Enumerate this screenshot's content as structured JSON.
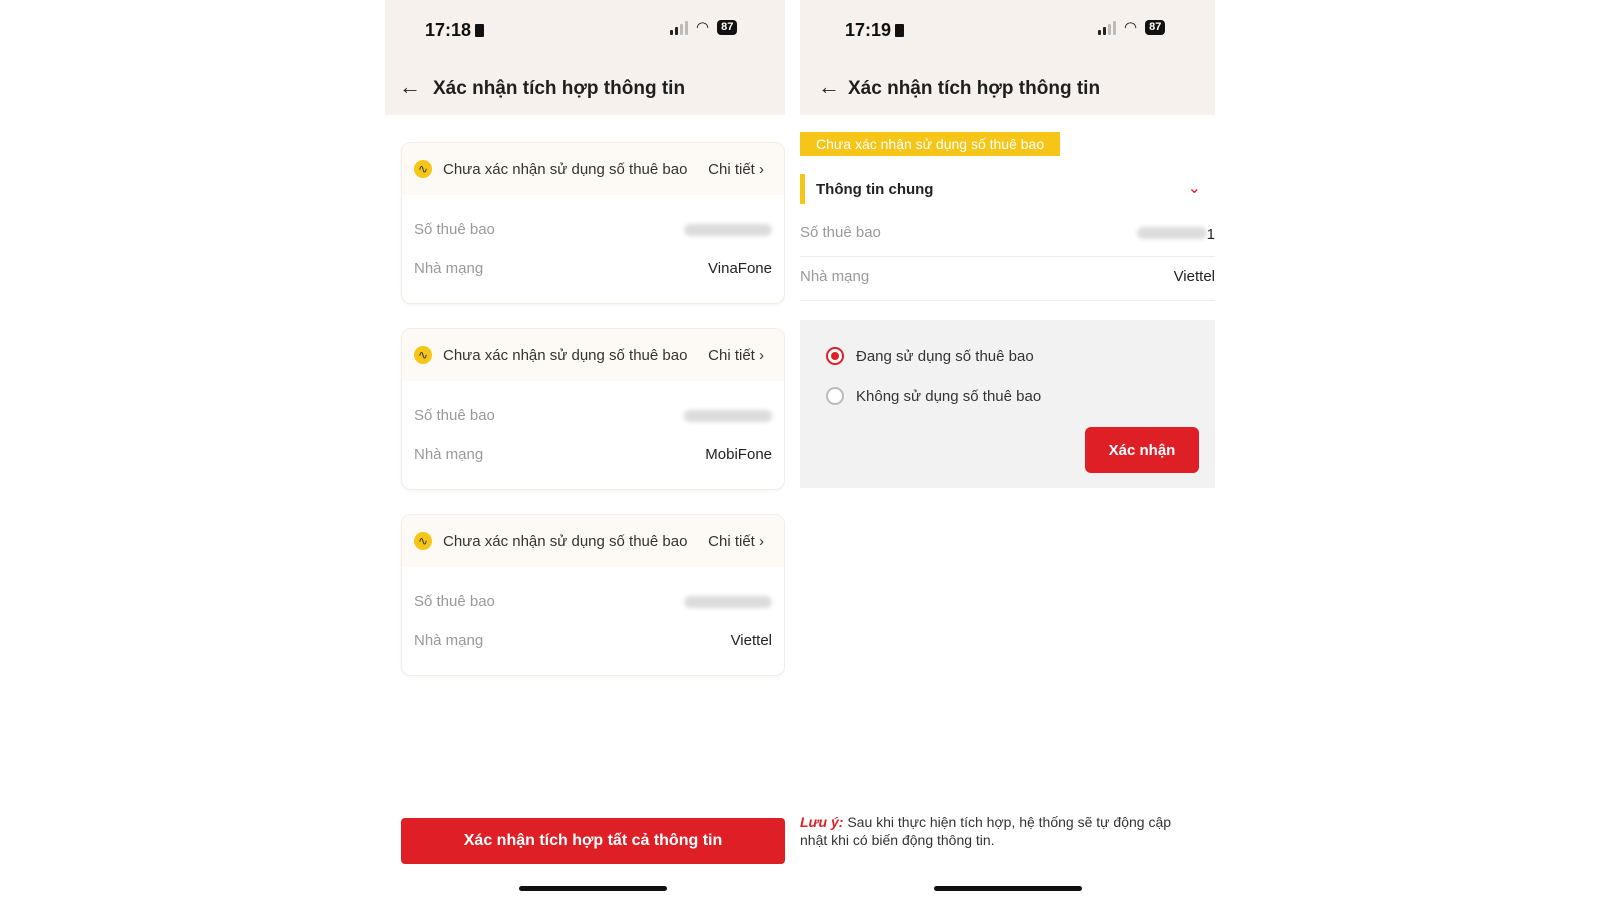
{
  "left": {
    "status": {
      "time": "17:18",
      "battery": "87"
    },
    "title": "Xác nhận tích hợp thông tin",
    "cards": [
      {
        "status": "Chưa xác nhận sử dụng số thuê bao",
        "detail": "Chi tiết",
        "subscriber_label": "Số thuê bao",
        "carrier_label": "Nhà mạng",
        "carrier": "VinaFone"
      },
      {
        "status": "Chưa xác nhận sử dụng số thuê bao",
        "detail": "Chi tiết",
        "subscriber_label": "Số thuê bao",
        "carrier_label": "Nhà mạng",
        "carrier": "MobiFone"
      },
      {
        "status": "Chưa xác nhận sử dụng số thuê bao",
        "detail": "Chi tiết",
        "subscriber_label": "Số thuê bao",
        "carrier_label": "Nhà mạng",
        "carrier": "Viettel"
      }
    ],
    "confirm_all": "Xác nhận tích hợp tất cả thông tin"
  },
  "right": {
    "status": {
      "time": "17:19",
      "battery": "87"
    },
    "title": "Xác nhận tích hợp thông tin",
    "badge": "Chưa xác nhận sử dụng số thuê bao",
    "section_title": "Thông tin chung",
    "subscriber_label": "Số thuê bao",
    "subscriber_suffix": "1",
    "carrier_label": "Nhà mạng",
    "carrier": "Viettel",
    "options": [
      {
        "label": "Đang sử dụng số thuê bao",
        "selected": true
      },
      {
        "label": "Không sử dụng số thuê bao",
        "selected": false
      }
    ],
    "confirm": "Xác nhận",
    "note_prefix": "Lưu ý:",
    "note_text": " Sau khi thực hiện tích hợp, hệ thống sẽ tự động cập nhật khi có biến động thông tin."
  },
  "colors": {
    "accent": "#de1f26",
    "warning": "#f5c518",
    "header_bg": "#f6f1ec"
  },
  "icons": [
    "back-arrow-icon",
    "warning-icon",
    "chevron-right-icon",
    "chevron-down-icon",
    "signal-icon",
    "wifi-icon",
    "battery-icon",
    "lock-icon"
  ]
}
